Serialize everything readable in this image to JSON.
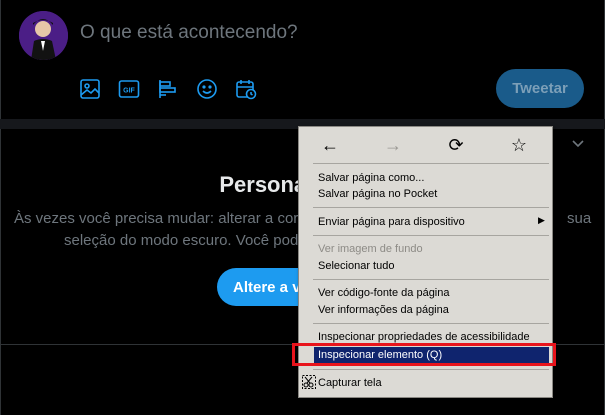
{
  "compose": {
    "placeholder": "O que está acontecendo?",
    "tweet_button": "Tweetar",
    "icons": [
      "image-icon",
      "gif-icon",
      "poll-icon",
      "emoji-icon",
      "schedule-icon"
    ]
  },
  "card": {
    "title": "Personalize sua",
    "text_line1": "Às vezes você precisa mudar: alterar a cor,",
    "text_line1_end": "sua",
    "text_line2": "seleção do modo escuro. Você pode",
    "button": "Altere a v"
  },
  "menu": {
    "nav": [
      "←",
      "→",
      "⟳",
      "☆"
    ],
    "items": [
      {
        "label": "Salvar página como...",
        "disabled": false
      },
      {
        "label": "Salvar página no Pocket",
        "disabled": false
      },
      {
        "label": "Enviar página para dispositivo",
        "disabled": false
      },
      {
        "label": "Ver imagem de fundo",
        "disabled": true
      },
      {
        "label": "Selecionar tudo",
        "disabled": false
      },
      {
        "label": "Ver código-fonte da página",
        "disabled": false
      },
      {
        "label": "Ver informações da página",
        "disabled": false
      },
      {
        "label": "Inspecionar propriedades de acessibilidade",
        "disabled": false
      },
      {
        "label": "Inspecionar elemento (Q)",
        "disabled": false,
        "highlighted": true
      },
      {
        "label": "Capturar tela",
        "disabled": false
      }
    ]
  },
  "colors": {
    "accent": "#1d9bf0",
    "highlight": "#0f246e",
    "annotation_box": "#e8141c"
  }
}
